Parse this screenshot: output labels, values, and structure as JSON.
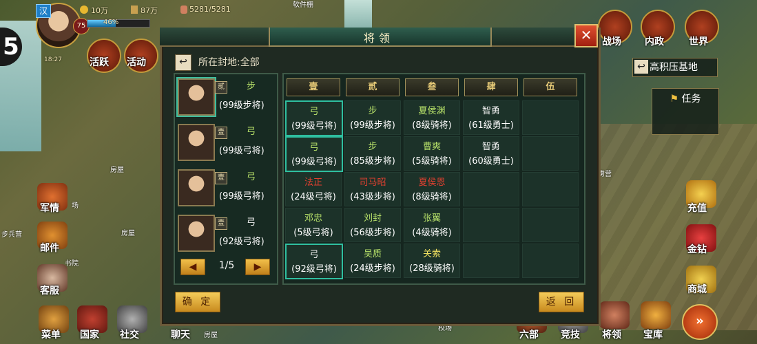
{
  "hud": {
    "nation": "汉",
    "level": "75",
    "exp_percent": "46%",
    "exp_fraction": 0.46,
    "coins": "10万",
    "food": "87万",
    "troops": "5281/5281",
    "time": "18:27",
    "side_number": "5"
  },
  "top_nav": {
    "active": "活跃",
    "events": "活动",
    "battle": "战场",
    "domestic": "内政",
    "world": "世界"
  },
  "map_labels": {
    "house1": "房屋",
    "house2": "房屋",
    "house3": "房屋",
    "barracks": "步兵营",
    "academy": "书院",
    "field": "场",
    "prison": "俘虏营",
    "training": "校场",
    "road": "软件棚"
  },
  "right_side": {
    "base": "高积压基地",
    "tasks": "任务",
    "recharge": "充值",
    "gold": "金钻",
    "shop": "商城"
  },
  "left_side": {
    "intel": "军情",
    "mail": "邮件",
    "service": "客服"
  },
  "bottom_nav": {
    "menu": "菜单",
    "nation": "国家",
    "social": "社交",
    "chat": "聊天",
    "six": "六部",
    "arena": "竞技",
    "generals": "将领",
    "treasury": "宝库"
  },
  "dialog": {
    "title": "将领",
    "fief_label": "所在封地:全部",
    "confirm": "确 定",
    "back": "返 回",
    "page": "1/5",
    "left_generals": [
      {
        "rank": "贰",
        "type": "步",
        "level": "(99级步将)",
        "type_color": "#b9e36a"
      },
      {
        "rank": "壹",
        "type": "弓",
        "level": "(99级弓将)",
        "type_color": "#b9e36a"
      },
      {
        "rank": "壹",
        "type": "弓",
        "level": "(99级弓将)",
        "type_color": "#b9e36a"
      },
      {
        "rank": "壹",
        "type": "弓",
        "level": "(92级弓将)",
        "type_color": "#f0f0f0"
      }
    ],
    "columns": [
      "壹",
      "贰",
      "叁",
      "肆",
      "伍"
    ],
    "rows": [
      [
        {
          "name": "弓",
          "level": "(99级弓将)",
          "color": "#b9e36a"
        },
        {
          "name": "步",
          "level": "(99级步将)",
          "color": "#b9e36a"
        },
        {
          "name": "夏侯渊",
          "level": "(8级骑将)",
          "color": "#b9e36a"
        },
        {
          "name": "智勇",
          "level": "(61级勇士)",
          "color": "#f0f0f0"
        },
        {
          "name": "",
          "level": "",
          "color": "#f0f0f0"
        }
      ],
      [
        {
          "name": "弓",
          "level": "(99级弓将)",
          "color": "#b9e36a"
        },
        {
          "name": "步",
          "level": "(85级步将)",
          "color": "#b9e36a"
        },
        {
          "name": "曹爽",
          "level": "(5级骑将)",
          "color": "#b9e36a"
        },
        {
          "name": "智勇",
          "level": "(60级勇士)",
          "color": "#f0f0f0"
        },
        {
          "name": "",
          "level": "",
          "color": "#f0f0f0"
        }
      ],
      [
        {
          "name": "法正",
          "level": "(24级弓将)",
          "color": "#e04030"
        },
        {
          "name": "司马昭",
          "level": "(43级步将)",
          "color": "#e04030"
        },
        {
          "name": "夏侯恩",
          "level": "(8级骑将)",
          "color": "#e04030"
        },
        {
          "name": "",
          "level": "",
          "color": "#f0f0f0"
        },
        {
          "name": "",
          "level": "",
          "color": "#f0f0f0"
        }
      ],
      [
        {
          "name": "邓忠",
          "level": "(5级弓将)",
          "color": "#b9e36a"
        },
        {
          "name": "刘封",
          "level": "(56级步将)",
          "color": "#b9e36a"
        },
        {
          "name": "张翼",
          "level": "(4级骑将)",
          "color": "#b9e36a"
        },
        {
          "name": "",
          "level": "",
          "color": "#f0f0f0"
        },
        {
          "name": "",
          "level": "",
          "color": "#f0f0f0"
        }
      ],
      [
        {
          "name": "弓",
          "level": "(92级弓将)",
          "color": "#f0f0f0"
        },
        {
          "name": "吴质",
          "level": "(24级步将)",
          "color": "#b9e36a"
        },
        {
          "name": "关索",
          "level": "(28级骑将)",
          "color": "#f0e060"
        },
        {
          "name": "",
          "level": "",
          "color": "#f0f0f0"
        },
        {
          "name": "",
          "level": "",
          "color": "#f0f0f0"
        }
      ]
    ]
  }
}
